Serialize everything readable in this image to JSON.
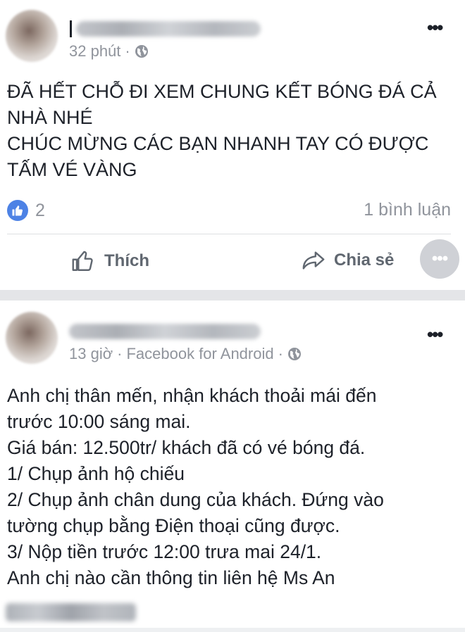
{
  "post1": {
    "time": "32 phút",
    "separator": "·",
    "text_lines": [
      "ĐÃ HẾT CHỖ ĐI XEM CHUNG KẾT BÓNG ĐÁ CẢ",
      "NHÀ NHÉ",
      "CHÚC MỪNG CÁC BẠN NHANH TAY CÓ ĐƯỢC",
      "TẤM VÉ VÀNG"
    ],
    "reaction_count": "2",
    "comment_count": "1 bình luận",
    "like_label": "Thích",
    "share_label": "Chia sẻ",
    "more_glyph": "•••",
    "circle_more_glyph": "•••"
  },
  "post2": {
    "time": "13 giờ",
    "separator": "·",
    "source": "Facebook for Android",
    "separator2": "·",
    "more_glyph": "•••",
    "text_lines": [
      "Anh chị thân mến, nhận khách thoải mái đến",
      "trước 10:00 sáng mai.",
      "Giá bán: 12.500tr/ khách đã có vé bóng đá.",
      "1/ Chụp ảnh hộ chiếu",
      "2/ Chụp ảnh chân dung của khách. Đứng vào",
      "tường chụp bằng Điện thoại cũng được.",
      "3/ Nộp tiền trước 12:00 trưa mai 24/1.",
      "Anh chị nào cần thông tin liên hệ Ms An"
    ]
  },
  "colors": {
    "like_blue": "#4d82e5",
    "meta_gray": "#90949c",
    "separator_gray": "#e4e5e8"
  },
  "icons": [
    "globe-icon",
    "like-icon",
    "thumbs-up-icon",
    "share-icon",
    "more-icon"
  ]
}
